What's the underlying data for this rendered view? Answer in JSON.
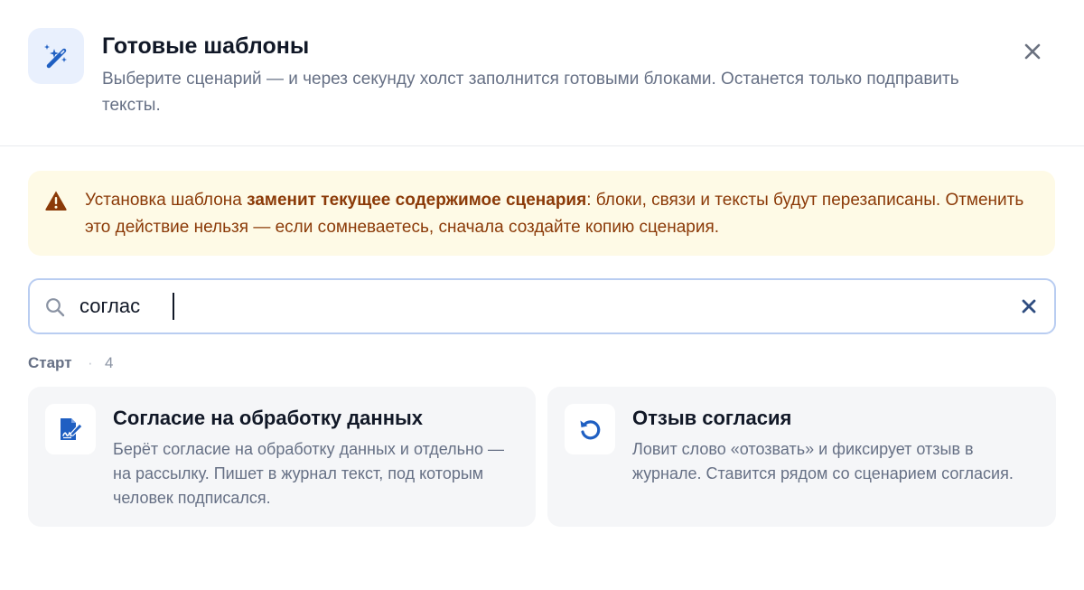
{
  "header": {
    "title": "Готовые шаблоны",
    "subtitle": "Выберите сценарий — и через секунду холст заполнится готовыми блоками. Останется только подправить тексты.",
    "icon": "magic-wand-icon",
    "close_icon": "close-icon"
  },
  "warning": {
    "icon": "warning-triangle-icon",
    "text_before": "Установка шаблона ",
    "text_bold": "заменит текущее содержимое сценария",
    "text_after": ": блоки, связи и тексты будут перезаписаны. Отменить это действие нельзя — если сомневаетесь, сначала создайте копию сценария."
  },
  "search": {
    "value": "соглас",
    "icon": "search-icon",
    "clear_icon": "clear-icon"
  },
  "section": {
    "label": "Старт",
    "separator": "·",
    "count": "4"
  },
  "cards": [
    {
      "title": "Согласие на обработку данных",
      "description": "Берёт согласие на обработку данных и отдельно — на рассылку. Пишет в журнал текст, под которым человек подписался.",
      "icon": "signed-document-icon"
    },
    {
      "title": "Отзыв согласия",
      "description": "Ловит слово «отозвать» и фиксирует отзыв в журнале. Ставится рядом со сценарием согласия.",
      "icon": "undo-icon"
    }
  ],
  "colors": {
    "accent": "#1f5fc2",
    "warning_bg": "#fefae6",
    "warning_text": "#8b3a08",
    "card_bg": "#f5f6f8"
  }
}
